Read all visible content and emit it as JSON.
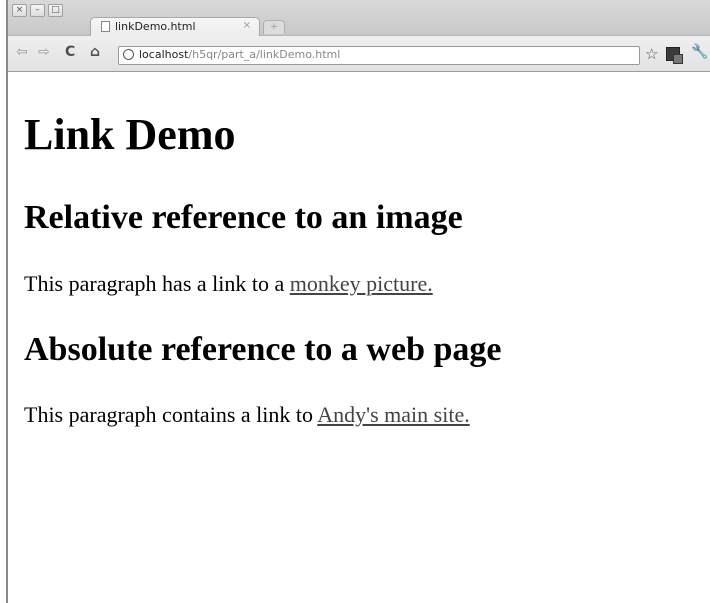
{
  "window": {
    "controls": [
      "×",
      "–",
      "□"
    ]
  },
  "tab": {
    "title": "linkDemo.html",
    "close_glyph": "×",
    "newtab_glyph": "+"
  },
  "toolbar": {
    "back_glyph": "⇦",
    "forward_glyph": "⇨",
    "reload_glyph": "C",
    "home_glyph": "⌂",
    "url_host": "localhost",
    "url_path": "/h5qr/part_a/linkDemo.html",
    "star_glyph": "☆",
    "wrench_glyph": "🔧",
    "icons": [
      "back-icon",
      "forward-icon",
      "reload-icon",
      "home-icon",
      "site-info-icon",
      "bookmark-star-icon",
      "page-action-icon",
      "wrench-icon"
    ]
  },
  "page": {
    "heading": "Link Demo",
    "section1": {
      "heading": "Relative reference to an image",
      "text": "This paragraph has a link to a ",
      "link": "monkey picture."
    },
    "section2": {
      "heading": "Absolute reference to a web page",
      "text": "This paragraph contains a link to ",
      "link": "Andy's main site."
    }
  }
}
